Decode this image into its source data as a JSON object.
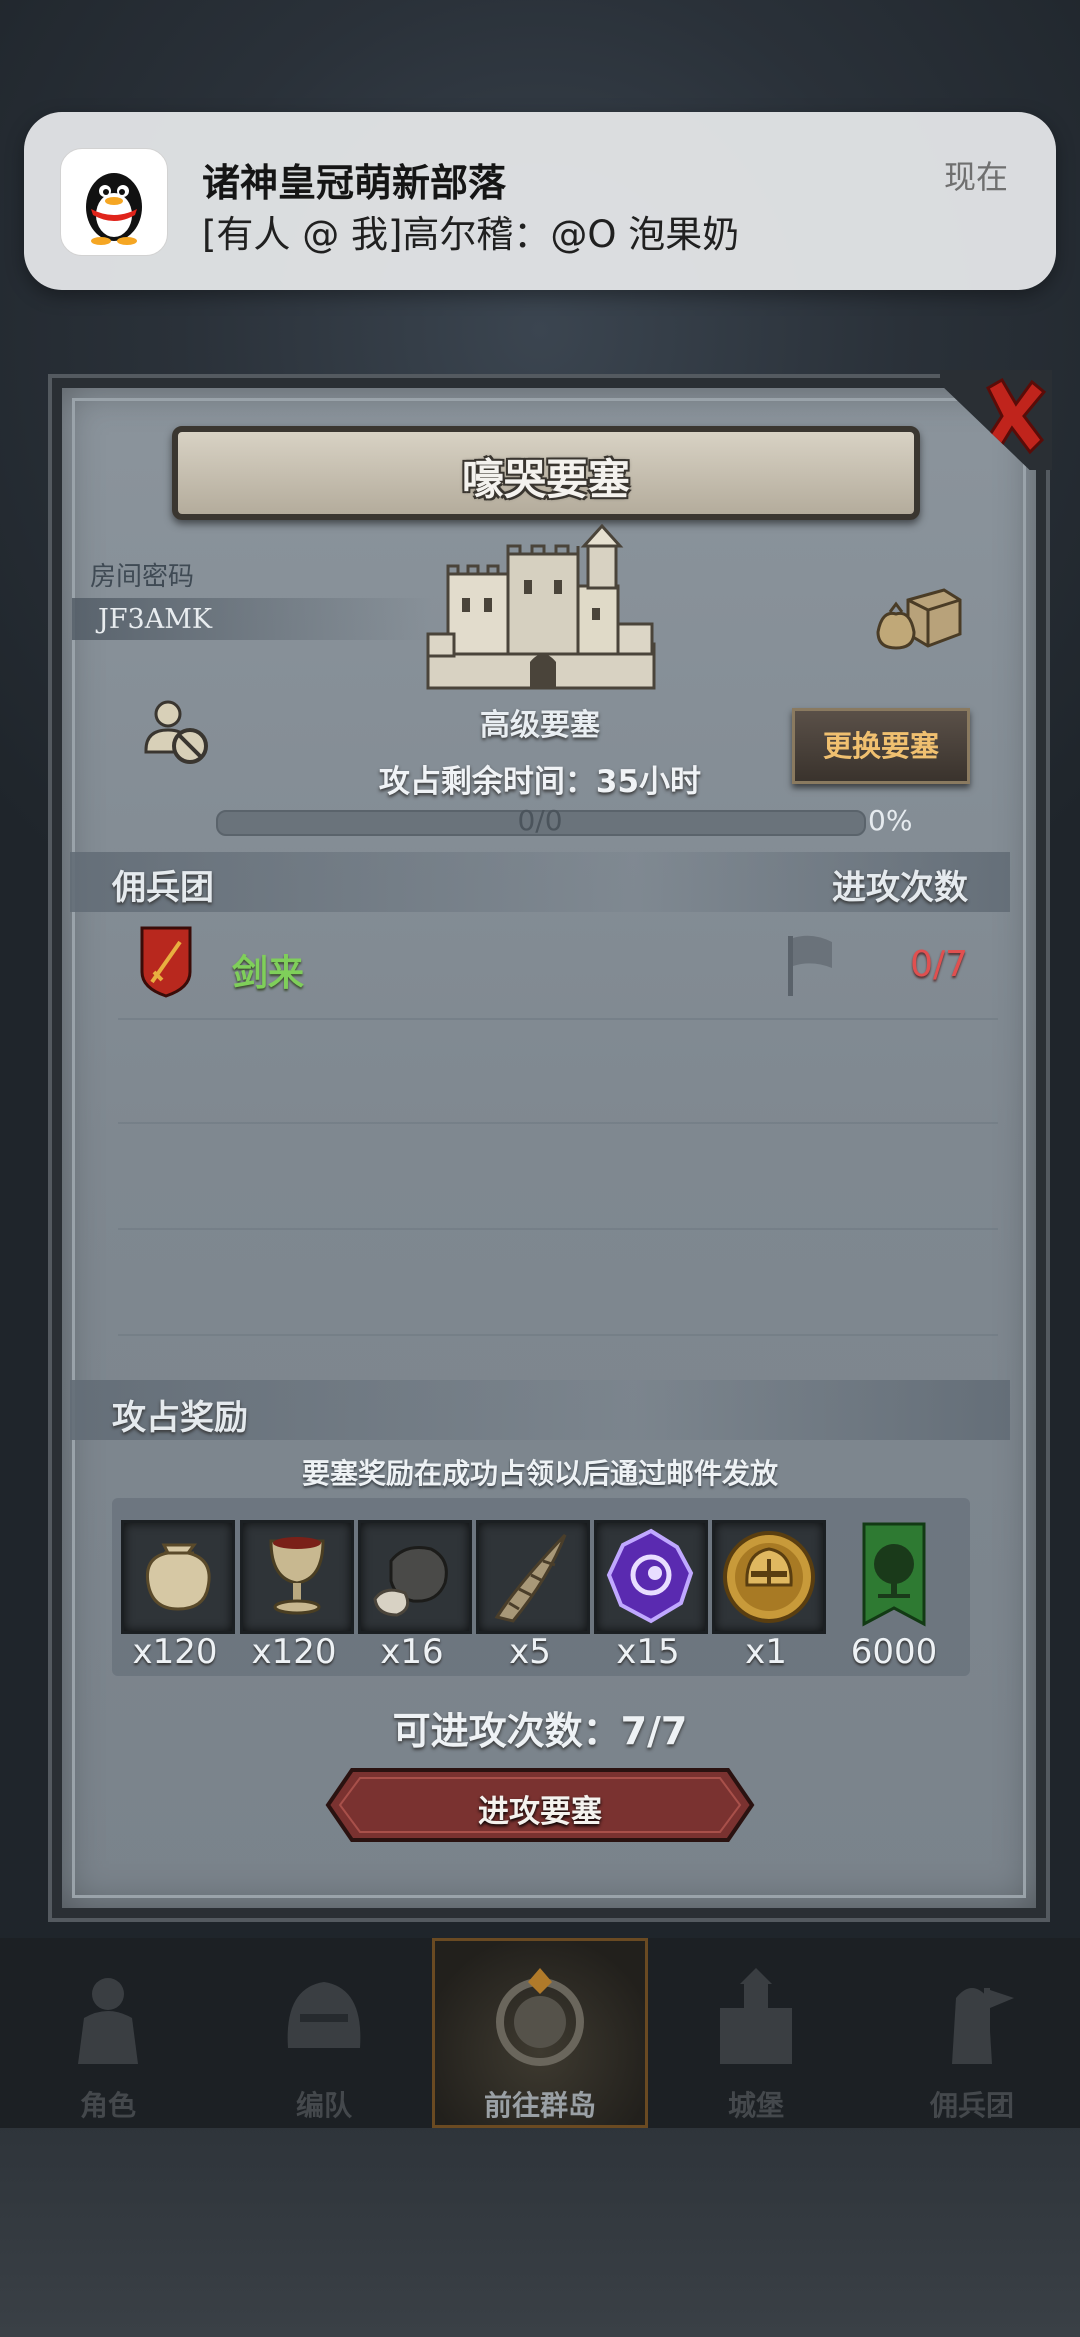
{
  "notification": {
    "title": "诸神皇冠萌新部落",
    "body": "[有人 @ 我]高尔稽：@O 泡果奶",
    "time": "现在",
    "app_icon": "qq-penguin-icon"
  },
  "fortress": {
    "title": "嚎哭要塞",
    "room_label": "房间密码",
    "room_code": "JF3AMK",
    "level": "高级要塞",
    "switch_button": "更换要塞",
    "time_left": "攻占剩余时间：35小时",
    "progress_text": "0/0",
    "progress_percent_text": "0%",
    "progress_fraction": 0,
    "castle_icon": "castle-icon",
    "supply_icon": "supply-crate-icon",
    "user_forbidden_icon": "user-forbidden-icon"
  },
  "mercenary_section": {
    "left_header": "佣兵团",
    "right_header": "进攻次数",
    "guilds": [
      {
        "name": "剑来",
        "attacks": "0/7",
        "emblem": "red-shield-sword-icon",
        "flag": "flag-icon"
      }
    ]
  },
  "rewards_section": {
    "header": "攻占奖励",
    "note": "要塞奖励在成功占领以后通过邮件发放",
    "items": [
      {
        "icon": "sack-icon",
        "count": "x120"
      },
      {
        "icon": "goblet-icon",
        "count": "x120"
      },
      {
        "icon": "ore-icon",
        "count": "x16"
      },
      {
        "icon": "horn-icon",
        "count": "x5"
      },
      {
        "icon": "purple-crystal-icon",
        "count": "x15"
      },
      {
        "icon": "golden-helmet-medal-icon",
        "count": "x1"
      },
      {
        "icon": "green-tree-banner-icon",
        "count": "6000"
      }
    ]
  },
  "attack": {
    "remaining": "可进攻次数：7/7",
    "button": "进攻要塞"
  },
  "bottom_nav": {
    "tabs": [
      {
        "label": "角色",
        "icon": "knight-icon",
        "active": false
      },
      {
        "label": "编队",
        "icon": "helmet-icon",
        "active": false
      },
      {
        "label": "前往群岛",
        "icon": "compass-map-icon",
        "active": true
      },
      {
        "label": "城堡",
        "icon": "castle-nav-icon",
        "active": false
      },
      {
        "label": "佣兵团",
        "icon": "mercenary-icon",
        "active": false
      }
    ]
  },
  "colors": {
    "accent_gold": "#f0c070",
    "guild_green": "#7fcf5a",
    "attack_red": "#e05050",
    "panel_gray": "#838c94",
    "button_maroon": "#7a3230"
  }
}
